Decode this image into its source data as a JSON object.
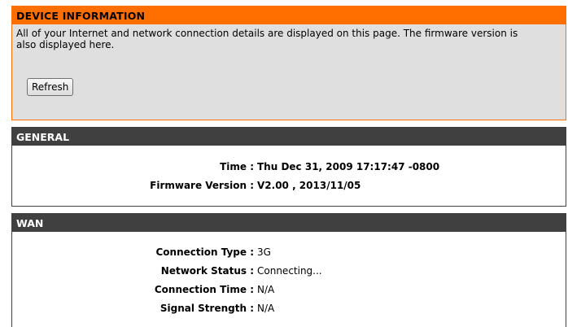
{
  "device_info": {
    "title": "DEVICE INFORMATION",
    "description": "All of your Internet and network connection details are displayed on this page. The firmware version is also displayed here.",
    "refresh_label": "Refresh"
  },
  "general": {
    "title": "GENERAL",
    "rows": [
      {
        "label": "Time :",
        "value": "Thu Dec 31, 2009 17:17:47 -0800"
      },
      {
        "label": "Firmware Version :",
        "value": "V2.00 , 2013/11/05"
      }
    ]
  },
  "wan": {
    "title": "WAN",
    "rows": [
      {
        "label": "Connection Type :",
        "value": "3G"
      },
      {
        "label": "Network Status :",
        "value": "Connecting..."
      },
      {
        "label": "Connection Time :",
        "value": "N/A"
      },
      {
        "label": "Signal Strength :",
        "value": "N/A"
      }
    ]
  },
  "colors": {
    "orange_header": "#ff6f00",
    "dark_header": "#404040",
    "info_background": "#dfdfdf"
  }
}
